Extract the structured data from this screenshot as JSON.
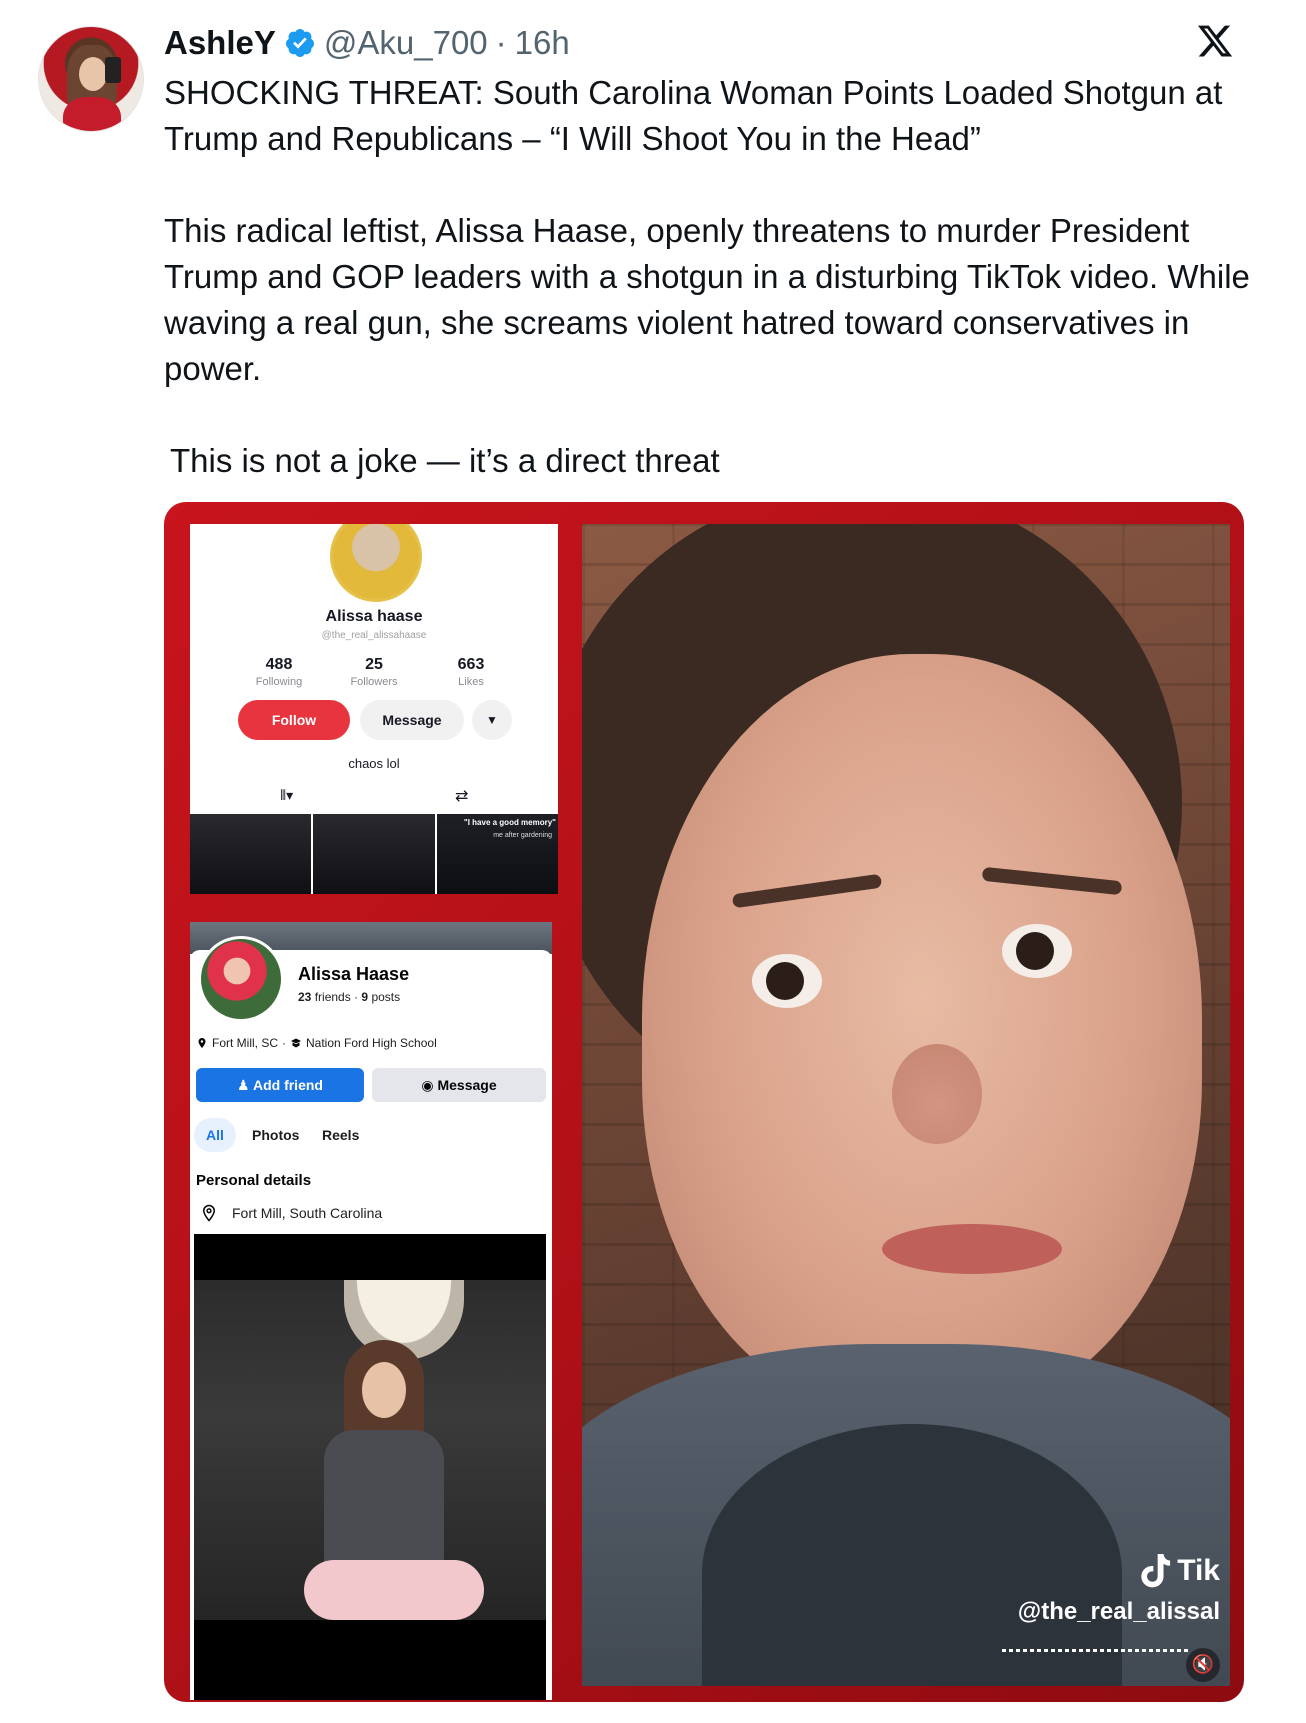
{
  "tweet": {
    "author_name": "AshleY",
    "handle": "@Aku_700",
    "separator": "·",
    "time": "16h",
    "paragraphs": [
      "SHOCKING THREAT: South Carolina Woman Points Loaded Shotgun at Trump and Republicans – “I Will Shoot You in the Head”",
      "This radical leftist, Alissa Haase, openly threatens to murder President Trump and GOP leaders with a shotgun in a disturbing TikTok video. While waving a real gun, she screams violent hatred toward conservatives in power.",
      "This is not a joke — it’s a direct threat"
    ]
  },
  "tiktok_profile": {
    "name": "Alissa haase",
    "handle": "@the_real_alissahaase",
    "stats": [
      {
        "number": "488",
        "label": "Following"
      },
      {
        "number": "25",
        "label": "Followers"
      },
      {
        "number": "663",
        "label": "Likes"
      }
    ],
    "follow_label": "Follow",
    "message_label": "Message",
    "more_icon": "▼",
    "bio": "chaos lol",
    "grid_icon": "⦀▾",
    "repost_icon": "⇄",
    "thumb_caption_1": "\"I have a good memory\"",
    "thumb_caption_2": "me after gardening"
  },
  "facebook_profile": {
    "name": "Alissa Haase",
    "friends_count": "23",
    "friends_label": "friends",
    "posts_count": "9",
    "posts_label": "posts",
    "dot": "·",
    "location_short": "Fort Mill, SC",
    "school": "Nation Ford High School",
    "add_friend_label": "Add friend",
    "message_label": "Message",
    "tabs": [
      "All",
      "Photos",
      "Reels"
    ],
    "personal_details_label": "Personal details",
    "address": "Fort Mill, South Carolina"
  },
  "video": {
    "brand": "Tik",
    "watermark_handle": "@the_real_alissal",
    "mute_icon": "🔇"
  },
  "colors": {
    "verified_blue": "#1d9bf0",
    "media_red": "#c8141c",
    "tiktok_red": "#e8343f",
    "facebook_blue": "#1b74e4"
  }
}
